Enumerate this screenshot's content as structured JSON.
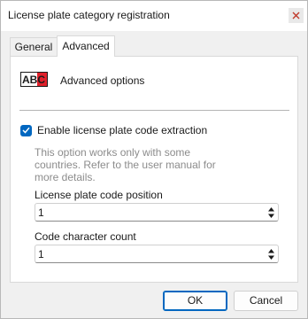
{
  "window": {
    "title": "License plate category registration",
    "close_icon": "close-icon"
  },
  "tabs": [
    {
      "label": "General",
      "selected": false
    },
    {
      "label": "Advanced",
      "selected": true
    }
  ],
  "advanced": {
    "logo_text": "ABC",
    "section_title": "Advanced options",
    "enable_extraction": {
      "label": "Enable license plate code extraction",
      "checked": true
    },
    "help_text": "This option works only with some countries. Refer to the user manual for more details.",
    "code_position": {
      "label": "License plate code position",
      "value": "1"
    },
    "char_count": {
      "label": "Code character count",
      "value": "1"
    }
  },
  "buttons": {
    "ok": "OK",
    "cancel": "Cancel"
  },
  "colors": {
    "accent": "#0067c0",
    "logo_red": "#e0202a"
  }
}
